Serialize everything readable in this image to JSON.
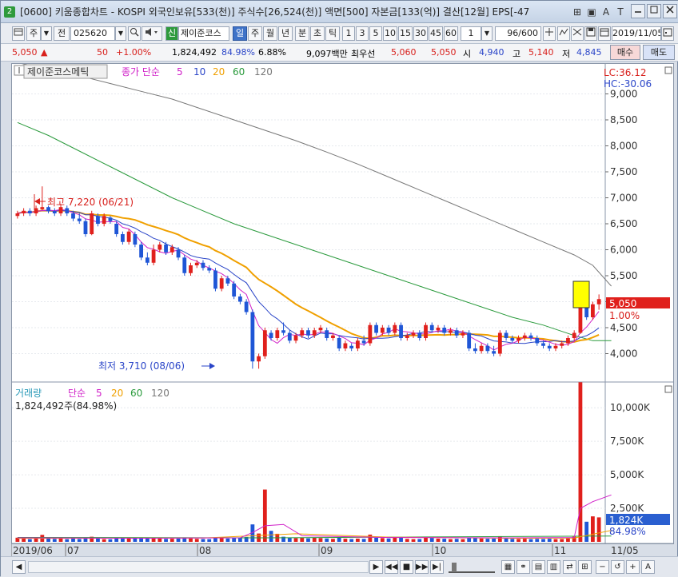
{
  "titlebar": {
    "badge": "2",
    "title": "[0600] 키움종합차트 - KOSPI 외국인보유[533(천)] 주식수[26,524(천)] 액면[500] 자본금[133(억)] 결산[12월] EPS[-47",
    "icons": [
      "grid-icon",
      "lock-icon",
      "font-icon",
      "tool-icon",
      "help-icon"
    ],
    "icon_glyphs": [
      "⊞",
      "▣",
      "A",
      "T",
      "?"
    ]
  },
  "toolbar": {
    "market": "주",
    "prev": "전",
    "code": "025620",
    "new_badge": "신",
    "stock_name": "제이준코스",
    "periods": [
      "일",
      "주",
      "월",
      "년",
      "분",
      "초",
      "틱"
    ],
    "selected_period": "일",
    "minutes": [
      "1",
      "3",
      "5",
      "10",
      "15",
      "30",
      "45",
      "60"
    ],
    "tick_value": "1",
    "count": "96/600",
    "date": "2019/11/05"
  },
  "quote": {
    "price": "5,050",
    "arrow": "▲",
    "change": "50",
    "change_pct": "+1.00%",
    "volume": "1,824,492",
    "vol_ratio": "84.98%",
    "turnover": "6.88%",
    "amount": "9,097백만",
    "priority": "최우선",
    "ask": "5,060",
    "bid": "5,050",
    "open_label": "시",
    "open": "4,940",
    "high_label": "고",
    "high": "5,140",
    "low_label": "저",
    "low": "4,845",
    "buy": "매수",
    "sell": "매도"
  },
  "price_panel": {
    "name": "제이준코스메틱",
    "ma_label": "종가 단순",
    "ma_periods": [
      "5",
      "10",
      "20",
      "60",
      "120"
    ],
    "ma_colors": [
      "#d020c8",
      "#2a45c8",
      "#f0a000",
      "#2a9a3c",
      "#777777"
    ],
    "lc": "LC:36.12",
    "hc": "HC:-30.06",
    "high_note": "최고 7,220 (06/21)",
    "low_note": "최저 3,710 (08/06)",
    "price_tag": "5,050",
    "pct_tag": "1.00%"
  },
  "volume_panel": {
    "label": "거래량",
    "ma_label": "단순",
    "ma_periods": [
      "5",
      "20",
      "60",
      "120"
    ],
    "ma_colors": [
      "#d020c8",
      "#f0a000",
      "#2a9a3c",
      "#777777"
    ],
    "value_text": "1,824,492주(84.98%)",
    "tag_value": "1,824K",
    "tag_pct": "84.98%"
  },
  "date_axis": {
    "labels": [
      "2019/06",
      "07",
      "08",
      "09",
      "10",
      "11"
    ],
    "last_label": "11/05"
  },
  "chart_data": {
    "type": "candlestick",
    "price_axis_labels": [
      "9,000",
      "8,500",
      "8,000",
      "7,500",
      "7,000",
      "6,500",
      "6,000",
      "5,500",
      "5,000",
      "4,500",
      "4,000"
    ],
    "ylim": [
      3500,
      9500
    ],
    "volume_axis_labels": [
      "10,000K",
      "7,500K",
      "5,000K",
      "2,500K"
    ],
    "volume_ylim": [
      0,
      11800
    ],
    "candles": [
      [
        6650,
        6750,
        6600,
        6700,
        310
      ],
      [
        6700,
        6800,
        6650,
        6750,
        260
      ],
      [
        6750,
        6800,
        6650,
        6700,
        200
      ],
      [
        6700,
        6850,
        6650,
        6800,
        340
      ],
      [
        6780,
        7220,
        6760,
        6820,
        520
      ],
      [
        6820,
        6850,
        6700,
        6740,
        270
      ],
      [
        6740,
        6800,
        6650,
        6700,
        220
      ],
      [
        6700,
        6880,
        6650,
        6820,
        290
      ],
      [
        6800,
        6850,
        6650,
        6700,
        200
      ],
      [
        6700,
        6750,
        6550,
        6600,
        240
      ],
      [
        6600,
        6700,
        6500,
        6550,
        210
      ],
      [
        6550,
        6600,
        6250,
        6300,
        330
      ],
      [
        6300,
        6750,
        6280,
        6700,
        380
      ],
      [
        6650,
        6700,
        6450,
        6500,
        250
      ],
      [
        6500,
        6700,
        6450,
        6650,
        200
      ],
      [
        6620,
        6650,
        6500,
        6550,
        190
      ],
      [
        6500,
        6550,
        6250,
        6300,
        300
      ],
      [
        6300,
        6350,
        6100,
        6150,
        280
      ],
      [
        6150,
        6400,
        6100,
        6350,
        260
      ],
      [
        6300,
        6350,
        6050,
        6100,
        240
      ],
      [
        6100,
        6150,
        5800,
        5850,
        320
      ],
      [
        5850,
        5950,
        5700,
        5750,
        270
      ],
      [
        5750,
        6100,
        5700,
        6000,
        300
      ],
      [
        6000,
        6150,
        5950,
        6100,
        260
      ],
      [
        6100,
        6150,
        5900,
        5950,
        220
      ],
      [
        5950,
        6100,
        5900,
        6050,
        230
      ],
      [
        6000,
        6050,
        5800,
        5850,
        240
      ],
      [
        5850,
        5900,
        5500,
        5550,
        330
      ],
      [
        5550,
        5750,
        5500,
        5700,
        260
      ],
      [
        5700,
        5800,
        5650,
        5750,
        220
      ],
      [
        5750,
        5800,
        5600,
        5650,
        210
      ],
      [
        5650,
        5700,
        5550,
        5600,
        200
      ],
      [
        5600,
        5650,
        5200,
        5250,
        330
      ],
      [
        5250,
        5500,
        5200,
        5450,
        300
      ],
      [
        5450,
        5500,
        5300,
        5350,
        250
      ],
      [
        5350,
        5400,
        5050,
        5100,
        280
      ],
      [
        5100,
        5150,
        4950,
        5000,
        300
      ],
      [
        5000,
        5050,
        4750,
        4800,
        360
      ],
      [
        4800,
        4850,
        3710,
        3850,
        1300
      ],
      [
        3850,
        4000,
        3710,
        3950,
        620
      ],
      [
        3950,
        4500,
        3900,
        4450,
        3900
      ],
      [
        4400,
        4450,
        4250,
        4300,
        820
      ],
      [
        4300,
        4500,
        4250,
        4450,
        600
      ],
      [
        4450,
        4600,
        4350,
        4400,
        380
      ],
      [
        4400,
        4450,
        4200,
        4250,
        320
      ],
      [
        4250,
        4400,
        4200,
        4350,
        280
      ],
      [
        4350,
        4500,
        4300,
        4450,
        330
      ],
      [
        4450,
        4500,
        4300,
        4350,
        260
      ],
      [
        4350,
        4500,
        4300,
        4450,
        300
      ],
      [
        4450,
        4550,
        4400,
        4500,
        280
      ],
      [
        4450,
        4500,
        4250,
        4300,
        250
      ],
      [
        4300,
        4400,
        4250,
        4350,
        220
      ],
      [
        4300,
        4350,
        4050,
        4100,
        300
      ],
      [
        4100,
        4250,
        4050,
        4200,
        230
      ],
      [
        4150,
        4200,
        4050,
        4100,
        210
      ],
      [
        4100,
        4300,
        4050,
        4250,
        240
      ],
      [
        4250,
        4350,
        4150,
        4200,
        220
      ],
      [
        4200,
        4600,
        4150,
        4550,
        540
      ],
      [
        4550,
        4600,
        4350,
        4400,
        300
      ],
      [
        4400,
        4550,
        4350,
        4500,
        280
      ],
      [
        4500,
        4550,
        4350,
        4400,
        250
      ],
      [
        4400,
        4600,
        4350,
        4550,
        330
      ],
      [
        4550,
        4600,
        4250,
        4300,
        300
      ],
      [
        4300,
        4400,
        4250,
        4350,
        220
      ],
      [
        4350,
        4450,
        4300,
        4400,
        200
      ],
      [
        4400,
        4450,
        4250,
        4300,
        210
      ],
      [
        4300,
        4600,
        4250,
        4550,
        350
      ],
      [
        4550,
        4600,
        4400,
        4450,
        290
      ],
      [
        4450,
        4550,
        4400,
        4500,
        240
      ],
      [
        4500,
        4550,
        4350,
        4400,
        230
      ],
      [
        4400,
        4500,
        4350,
        4450,
        200
      ],
      [
        4450,
        4500,
        4300,
        4350,
        220
      ],
      [
        4350,
        4450,
        4300,
        4400,
        200
      ],
      [
        4400,
        4450,
        4050,
        4100,
        330
      ],
      [
        4100,
        4200,
        4000,
        4050,
        280
      ],
      [
        4050,
        4200,
        4000,
        4150,
        250
      ],
      [
        4150,
        4200,
        4000,
        4050,
        230
      ],
      [
        4050,
        4150,
        3950,
        4000,
        240
      ],
      [
        4000,
        4450,
        3950,
        4400,
        420
      ],
      [
        4400,
        4450,
        4250,
        4300,
        260
      ],
      [
        4300,
        4350,
        4200,
        4250,
        220
      ],
      [
        4250,
        4350,
        4200,
        4300,
        210
      ],
      [
        4300,
        4400,
        4250,
        4350,
        230
      ],
      [
        4350,
        4400,
        4250,
        4300,
        200
      ],
      [
        4300,
        4350,
        4150,
        4200,
        220
      ],
      [
        4200,
        4250,
        4100,
        4150,
        210
      ],
      [
        4150,
        4200,
        4050,
        4100,
        230
      ],
      [
        4100,
        4200,
        4050,
        4150,
        200
      ],
      [
        4150,
        4250,
        4100,
        4200,
        210
      ],
      [
        4200,
        4350,
        4150,
        4300,
        260
      ],
      [
        4300,
        4450,
        4250,
        4400,
        380
      ],
      [
        4400,
        5270,
        4380,
        4960,
        11900
      ],
      [
        4960,
        5050,
        4650,
        4700,
        1500
      ],
      [
        4700,
        5000,
        4650,
        4950,
        1900
      ],
      [
        4950,
        5140,
        4845,
        5050,
        1824
      ]
    ],
    "ma120": [
      [
        0,
        9600
      ],
      [
        5,
        9480
      ],
      [
        10,
        9350
      ],
      [
        15,
        9200
      ],
      [
        20,
        9050
      ],
      [
        25,
        8900
      ],
      [
        30,
        8700
      ],
      [
        35,
        8500
      ],
      [
        40,
        8300
      ],
      [
        45,
        8100
      ],
      [
        50,
        7880
      ],
      [
        55,
        7650
      ],
      [
        60,
        7400
      ],
      [
        65,
        7150
      ],
      [
        70,
        6900
      ],
      [
        75,
        6650
      ],
      [
        80,
        6400
      ],
      [
        85,
        6150
      ],
      [
        90,
        5900
      ],
      [
        93,
        5700
      ],
      [
        96,
        5300
      ]
    ],
    "ma60": [
      [
        0,
        8450
      ],
      [
        5,
        8200
      ],
      [
        10,
        7900
      ],
      [
        15,
        7600
      ],
      [
        20,
        7300
      ],
      [
        25,
        7000
      ],
      [
        30,
        6750
      ],
      [
        35,
        6500
      ],
      [
        40,
        6300
      ],
      [
        45,
        6100
      ],
      [
        50,
        5900
      ],
      [
        55,
        5700
      ],
      [
        60,
        5500
      ],
      [
        65,
        5300
      ],
      [
        70,
        5100
      ],
      [
        75,
        4900
      ],
      [
        80,
        4700
      ],
      [
        85,
        4550
      ],
      [
        90,
        4350
      ],
      [
        93,
        4250
      ],
      [
        96,
        4250
      ]
    ],
    "volume_lines": {
      "ma5": [
        [
          0,
          300
        ],
        [
          20,
          270
        ],
        [
          36,
          300
        ],
        [
          38,
          700
        ],
        [
          40,
          1200
        ],
        [
          43,
          1300
        ],
        [
          46,
          450
        ],
        [
          60,
          320
        ],
        [
          80,
          300
        ],
        [
          90,
          320
        ],
        [
          91,
          2500
        ],
        [
          93,
          3000
        ],
        [
          96,
          3500
        ]
      ],
      "ma20": [
        [
          0,
          260
        ],
        [
          30,
          280
        ],
        [
          45,
          600
        ],
        [
          60,
          350
        ],
        [
          80,
          260
        ],
        [
          90,
          280
        ],
        [
          96,
          850
        ]
      ],
      "ma60": [
        [
          0,
          330
        ],
        [
          40,
          300
        ],
        [
          60,
          350
        ],
        [
          96,
          430
        ]
      ]
    }
  }
}
